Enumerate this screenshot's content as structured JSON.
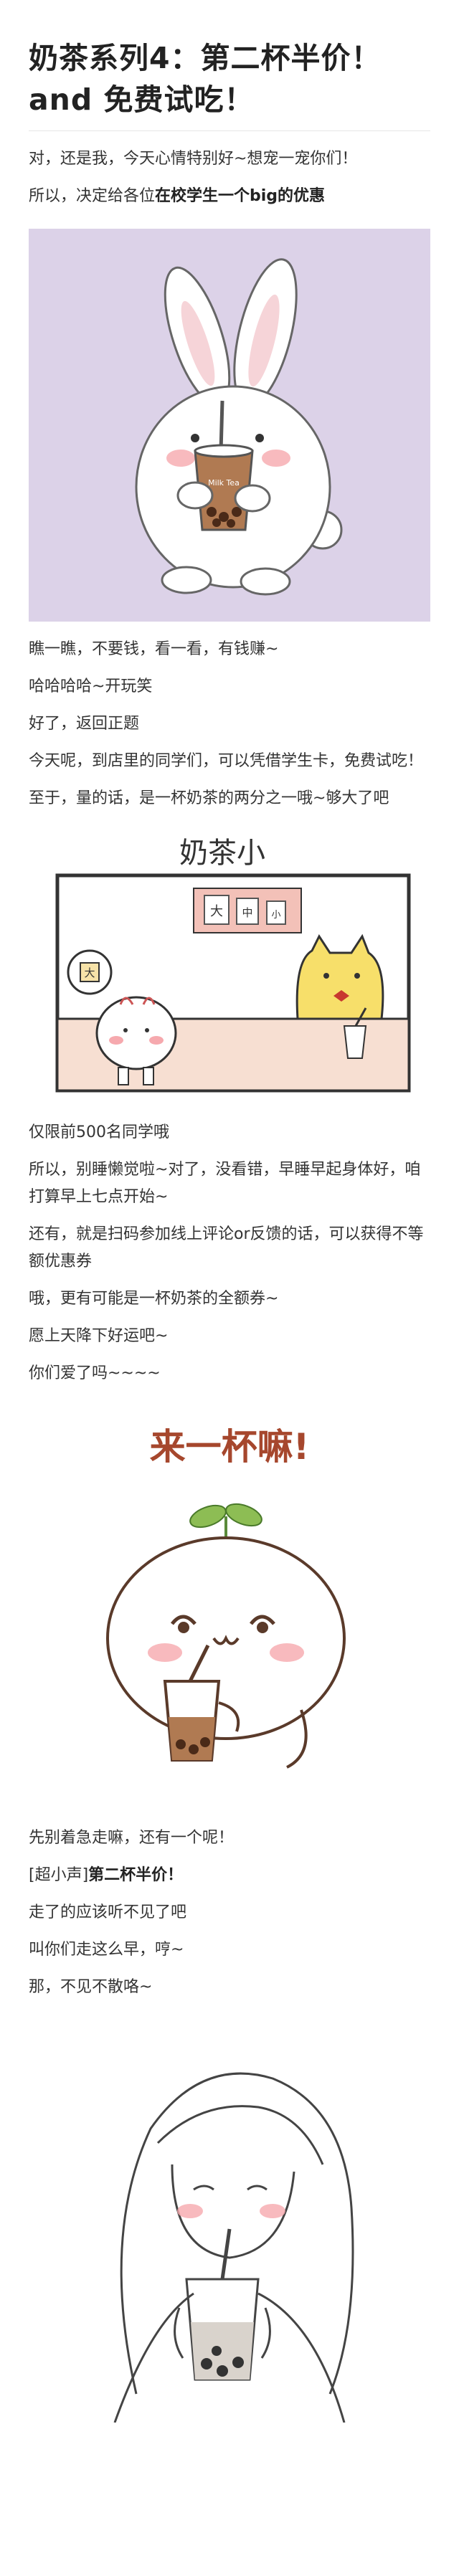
{
  "article": {
    "title_line1": "奶茶系列4：第二杯半价！",
    "title_line2": "and 免费试吃！",
    "intro": [
      "对，还是我，今天心情特别好~想宠一宠你们！"
    ],
    "decision_prefix": "所以，决定给各位",
    "decision_bold": "在校学生一个big的优惠",
    "section1": [
      "瞧一瞧，不要钱，看一看，有钱赚~",
      "哈哈哈哈~开玩笑",
      "好了，返回正题",
      "今天呢，到店里的同学们，可以凭借学生卡，免费试吃！",
      "至于，量的话，是一杯奶茶的两分之一哦~够大了吧"
    ],
    "section2": [
      "仅限前500名同学哦",
      "所以，别睡懒觉啦~对了，没看错，早睡早起身体好，咱打算早上七点开始~",
      "还有，就是扫码参加线上评论or反馈的话，可以获得不等额优惠券",
      "哦，更有可能是一杯奶茶的全额券~",
      "愿上天降下好运吧~",
      "你们爱了吗~~~~"
    ],
    "section3_first": "先别着急走嘛，还有一个呢！",
    "whisper_prefix": "[超小声]",
    "whisper_bold": "第二杯半价！",
    "section3": [
      "走了的应该听不见了吧",
      "叫你们走这么早，哼~",
      "那，不见不散咯~"
    ]
  },
  "illustrations": {
    "shop_sign": "奶茶小",
    "shop_menu_1": "大",
    "shop_menu_2": "中",
    "shop_menu_3": "小",
    "bubble_text": "大",
    "cup_label": "Milk Tea",
    "sprout_title": "来一杯嘛!"
  },
  "colors": {
    "rabbit_bg": "#dcd2e8",
    "tea_brown": "#b07a52",
    "blush": "#f6a9ae",
    "yellow_cat": "#f7df6a",
    "bow_red": "#c8382f",
    "sprout_green": "#8dbd54",
    "title_red": "#a6472d"
  }
}
